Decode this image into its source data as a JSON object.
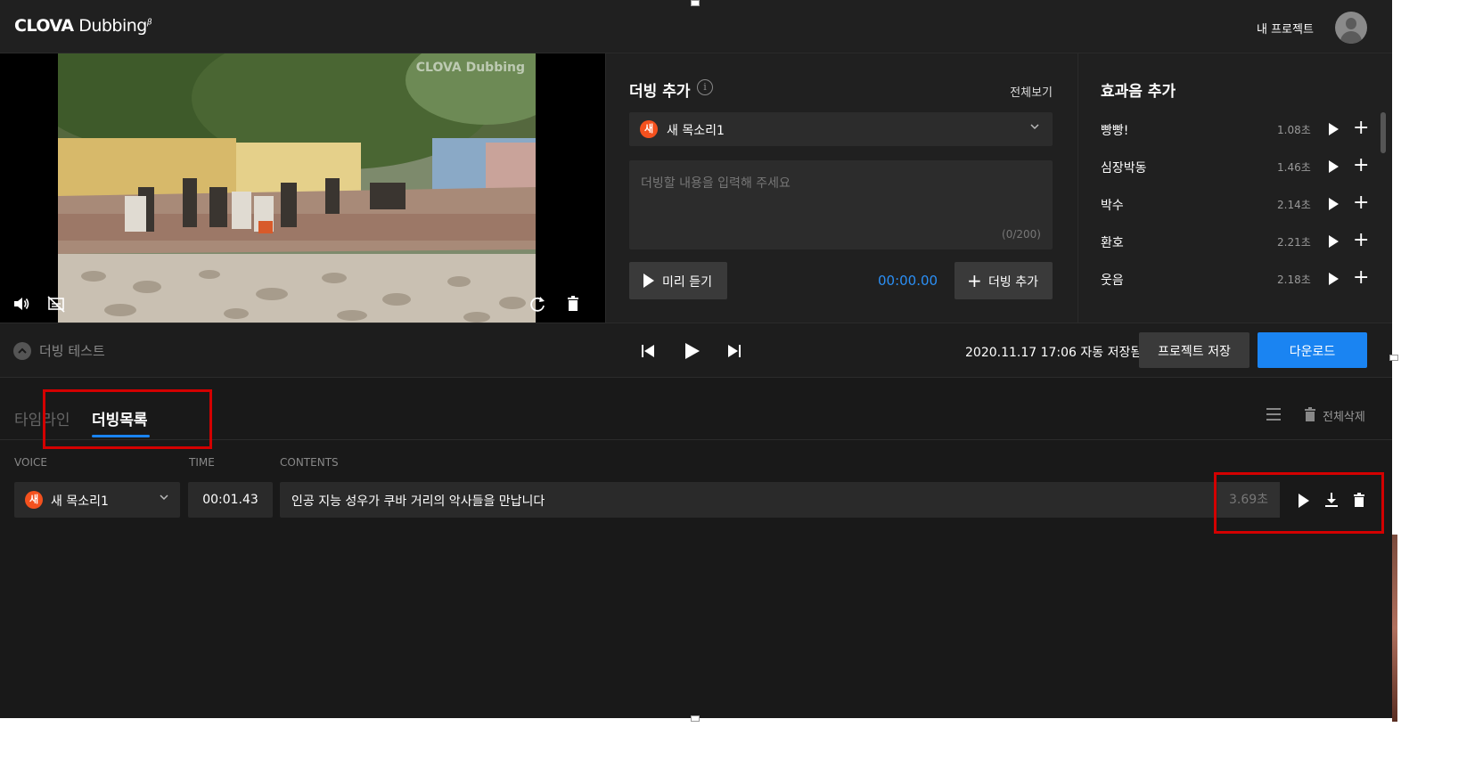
{
  "header": {
    "logo_bold": "CLOVA",
    "logo_text": "Dubbing",
    "logo_beta": "β",
    "my_projects": "내 프로젝트"
  },
  "video": {
    "watermark": "CLOVA Dubbing",
    "icons": [
      "volume-icon",
      "subtitle-off-icon",
      "refresh-icon",
      "trash-icon"
    ]
  },
  "dub_add": {
    "title": "더빙 추가",
    "view_all": "전체보기",
    "voice_badge": "새",
    "voice_name": "새 목소리1",
    "input_placeholder": "더빙할 내용을 입력해 주세요",
    "char_count": "(0/200)",
    "preview_label": "미리 듣기",
    "time": "00:00.00",
    "add_label": "더빙 추가"
  },
  "sfx": {
    "title": "효과음 추가",
    "items": [
      {
        "name": "빵빵!",
        "duration": "1.08초"
      },
      {
        "name": "심장박동",
        "duration": "1.46초"
      },
      {
        "name": "박수",
        "duration": "2.14초"
      },
      {
        "name": "환호",
        "duration": "2.21초"
      },
      {
        "name": "웃음",
        "duration": "2.18초"
      }
    ]
  },
  "playbar": {
    "project_name": "더빙 테스트",
    "autosave": "2020.11.17 17:06 자동 저장됨",
    "save_label": "프로젝트 저장",
    "download_label": "다운로드"
  },
  "list": {
    "tabs": [
      "타임라인",
      "더빙목록"
    ],
    "active_tab": "더빙목록",
    "delete_all": "전체삭제",
    "columns": [
      "VOICE",
      "TIME",
      "CONTENTS"
    ],
    "rows": [
      {
        "voice_badge": "새",
        "voice": "새 목소리1",
        "time": "00:01.43",
        "contents": "인공 지능 성우가 쿠바 거리의 악사들을 만납니다",
        "duration": "3.69초"
      }
    ]
  },
  "colors": {
    "accent": "#1a84f2",
    "badge": "#f4511e",
    "highlight": "#d30000",
    "background": "#191919"
  }
}
